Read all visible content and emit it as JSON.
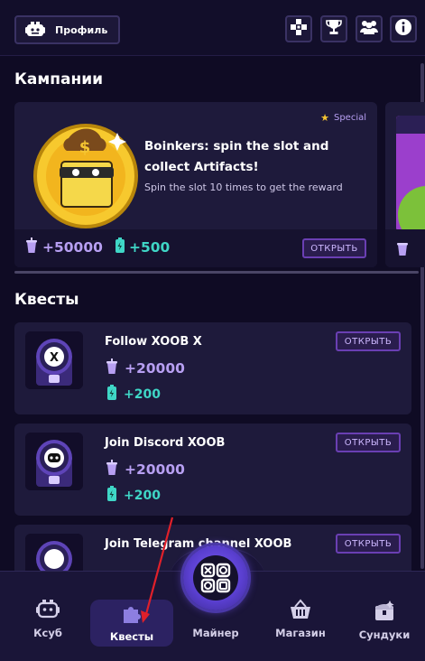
{
  "header": {
    "profile_label": "Профиль",
    "icons": [
      "gamepad-icon",
      "trophy-icon",
      "friends-icon",
      "info-icon"
    ]
  },
  "campaigns": {
    "title": "Кампании",
    "card": {
      "badge": "Special",
      "title": "Boinkers: spin the slot and collect Artifacts!",
      "description": "Spin the slot 10 times to get the reward",
      "reward_primary": "+50000",
      "reward_secondary": "+500",
      "button": "ОТКРЫТЬ"
    }
  },
  "quests": {
    "title": "Квесты",
    "items": [
      {
        "title": "Follow XOOB X",
        "reward_primary": "+20000",
        "reward_secondary": "+200",
        "button": "ОТКРЫТЬ",
        "icon": "x-logo-icon"
      },
      {
        "title": "Join Discord XOOB",
        "reward_primary": "+20000",
        "reward_secondary": "+200",
        "button": "ОТКРЫТЬ",
        "icon": "discord-logo-icon"
      },
      {
        "title": "Join Telegram channel XOOB",
        "reward_primary": "",
        "reward_secondary": "",
        "button": "ОТКРЫТЬ",
        "icon": "telegram-logo-icon"
      }
    ]
  },
  "nav": {
    "items": [
      {
        "label": "Ксуб",
        "icon": "cube-controller-icon"
      },
      {
        "label": "Квесты",
        "icon": "puzzle-icon",
        "active": true
      },
      {
        "label": "Майнер",
        "icon": "xoob-logo-icon"
      },
      {
        "label": "Магазин",
        "icon": "basket-icon"
      },
      {
        "label": "Сундуки",
        "icon": "chest-icon"
      }
    ]
  },
  "colors": {
    "background": "#0f0b24",
    "card": "#1e1a3b",
    "accent_purple": "#b79ff2",
    "accent_teal": "#3fd6c6",
    "annotation_arrow": "#e0202a"
  }
}
